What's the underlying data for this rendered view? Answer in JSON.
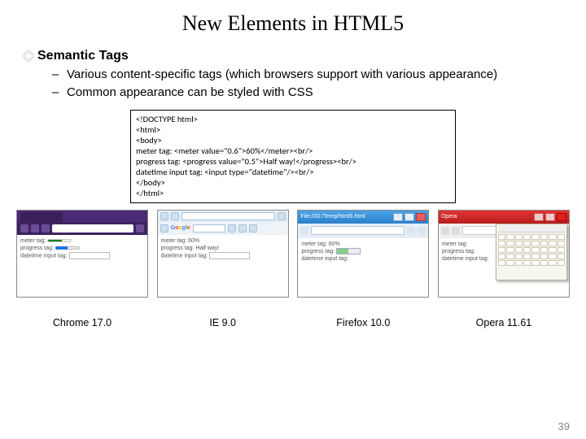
{
  "title": "New Elements in HTML5",
  "section_heading": "Semantic Tags",
  "bullets": [
    "Various content-specific tags (which browsers support with various appearance)",
    "Common appearance can be styled with CSS"
  ],
  "code_lines": [
    "<!DOCTYPE html>",
    "<html>",
    "<body>",
    "meter tag: <meter value=\"0.6\">60%</meter><br/>",
    "progress tag: <progress value=\"0.5\">Half way!</progress><br/>",
    "datetime input tag: <input type=\"datetime\"/><br/>",
    "</body>",
    "</html>"
  ],
  "page_render": {
    "line1_label": "meter tag:",
    "line1_text_fallback": "60%",
    "line2_label": "progress tag:",
    "line2_text_fallback": "Half way!",
    "line3_label": "datetime input tag:"
  },
  "shots": [
    {
      "id": "chrome",
      "caption": "Chrome 17.0"
    },
    {
      "id": "ie",
      "caption": "IE 9.0"
    },
    {
      "id": "firefox",
      "caption": "Firefox 10.0",
      "window_title": "File:///D:/Temp/html5.html"
    },
    {
      "id": "opera",
      "caption": "Opera 11.61",
      "window_title": "Opera"
    }
  ],
  "ie_ui": {
    "google_label": "Google"
  },
  "page_number": "39"
}
